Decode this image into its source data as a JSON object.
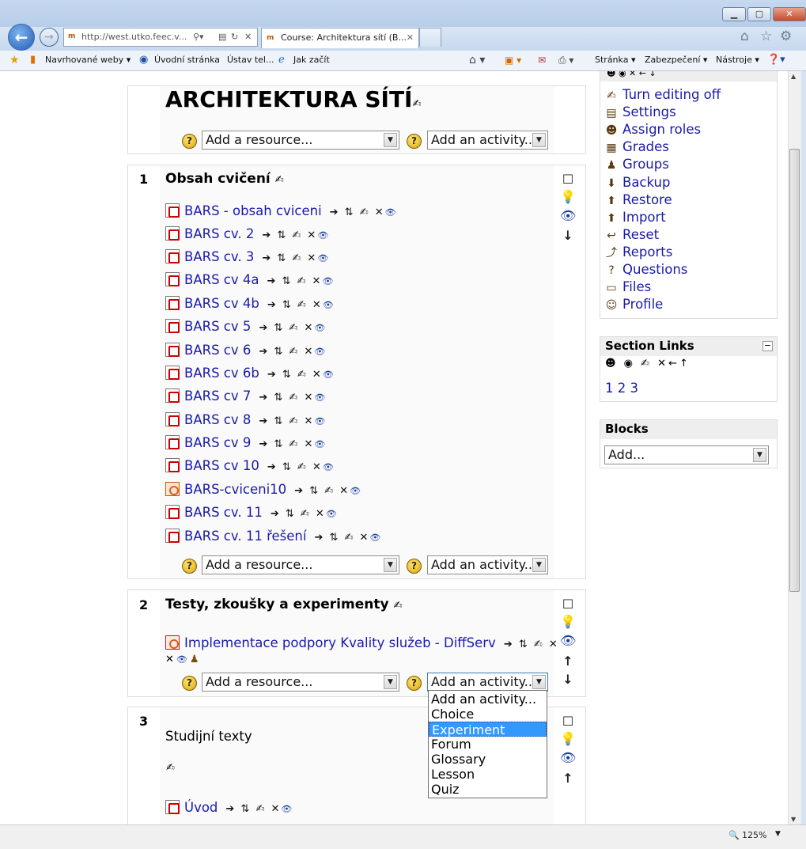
{
  "browser": {
    "address": "http://west.utko.feec.v...",
    "tab_title": "Course: Architektura sítí (B...",
    "favorites": [
      {
        "label": "Navrhované weby",
        "dropdown": "▾"
      },
      {
        "label": "Úvodní stránka"
      },
      {
        "label": "Ústav tel..."
      },
      {
        "label": "Jak začít"
      }
    ],
    "commands": [
      {
        "label": "Stránka ▾"
      },
      {
        "label": "Zabezpečení ▾"
      },
      {
        "label": "Nástroje ▾"
      }
    ],
    "zoom": "125%"
  },
  "course": {
    "title": "ARCHITEKTURA SÍTÍ",
    "add_resource": "Add a resource...",
    "add_activity": "Add an activity...",
    "edit_glyph": "✍",
    "actions": "➔ ⇅ ✍ ✕",
    "eye_glyph": "👁"
  },
  "sections": [
    {
      "number": "1",
      "title": "Obsah cvičení",
      "resources": [
        {
          "label": "BARS - obsah cviceni",
          "kind": "pdf"
        },
        {
          "label": "BARS cv. 2",
          "kind": "pdf"
        },
        {
          "label": "BARS cv. 3",
          "kind": "pdf"
        },
        {
          "label": "BARS cv 4a",
          "kind": "pdf"
        },
        {
          "label": "BARS cv 4b",
          "kind": "pdf"
        },
        {
          "label": "BARS cv 5",
          "kind": "pdf"
        },
        {
          "label": "BARS cv 6",
          "kind": "pdf"
        },
        {
          "label": "BARS cv 6b",
          "kind": "pdf"
        },
        {
          "label": "BARS cv 7",
          "kind": "pdf"
        },
        {
          "label": "BARS cv 8",
          "kind": "pdf"
        },
        {
          "label": "BARS cv 9",
          "kind": "pdf"
        },
        {
          "label": "BARS cv 10",
          "kind": "pdf"
        },
        {
          "label": "BARS-cviceni10",
          "kind": "ppt"
        },
        {
          "label": "BARS cv. 11",
          "kind": "pdf"
        },
        {
          "label": "BARS cv. 11 řešení",
          "kind": "pdf"
        }
      ]
    },
    {
      "number": "2",
      "title": "Testy, zkoušky a experimenty",
      "resources": [
        {
          "label": "Implementace podpory Kvality služeb - DiffServ",
          "kind": "experiment"
        }
      ]
    },
    {
      "number": "3",
      "title": "",
      "summary": "Studijní texty",
      "resources": [
        {
          "label": "Úvod",
          "kind": "pdf"
        }
      ]
    }
  ],
  "admin_block": {
    "items": [
      {
        "label": "Turn editing off",
        "icon": "✍"
      },
      {
        "label": "Settings",
        "icon": "▤"
      },
      {
        "label": "Assign roles",
        "icon": "☻"
      },
      {
        "label": "Grades",
        "icon": "▦"
      },
      {
        "label": "Groups",
        "icon": "♟"
      },
      {
        "label": "Backup",
        "icon": "⬇"
      },
      {
        "label": "Restore",
        "icon": "⬆"
      },
      {
        "label": "Import",
        "icon": "⬆"
      },
      {
        "label": "Reset",
        "icon": "↩"
      },
      {
        "label": "Reports",
        "icon": "⤴"
      },
      {
        "label": "Questions",
        "icon": "?"
      },
      {
        "label": "Files",
        "icon": "▭"
      },
      {
        "label": "Profile",
        "icon": "☺"
      }
    ]
  },
  "section_links": {
    "title": "Section Links",
    "collapse": "−",
    "links": [
      "1",
      "2",
      "3"
    ]
  },
  "blocks_block": {
    "title": "Blocks",
    "add": "Add..."
  },
  "activity_dropdown": {
    "options": [
      "Add an activity...",
      "Choice",
      "Experiment",
      "Forum",
      "Glossary",
      "Lesson",
      "Quiz"
    ],
    "selected": "Experiment"
  }
}
